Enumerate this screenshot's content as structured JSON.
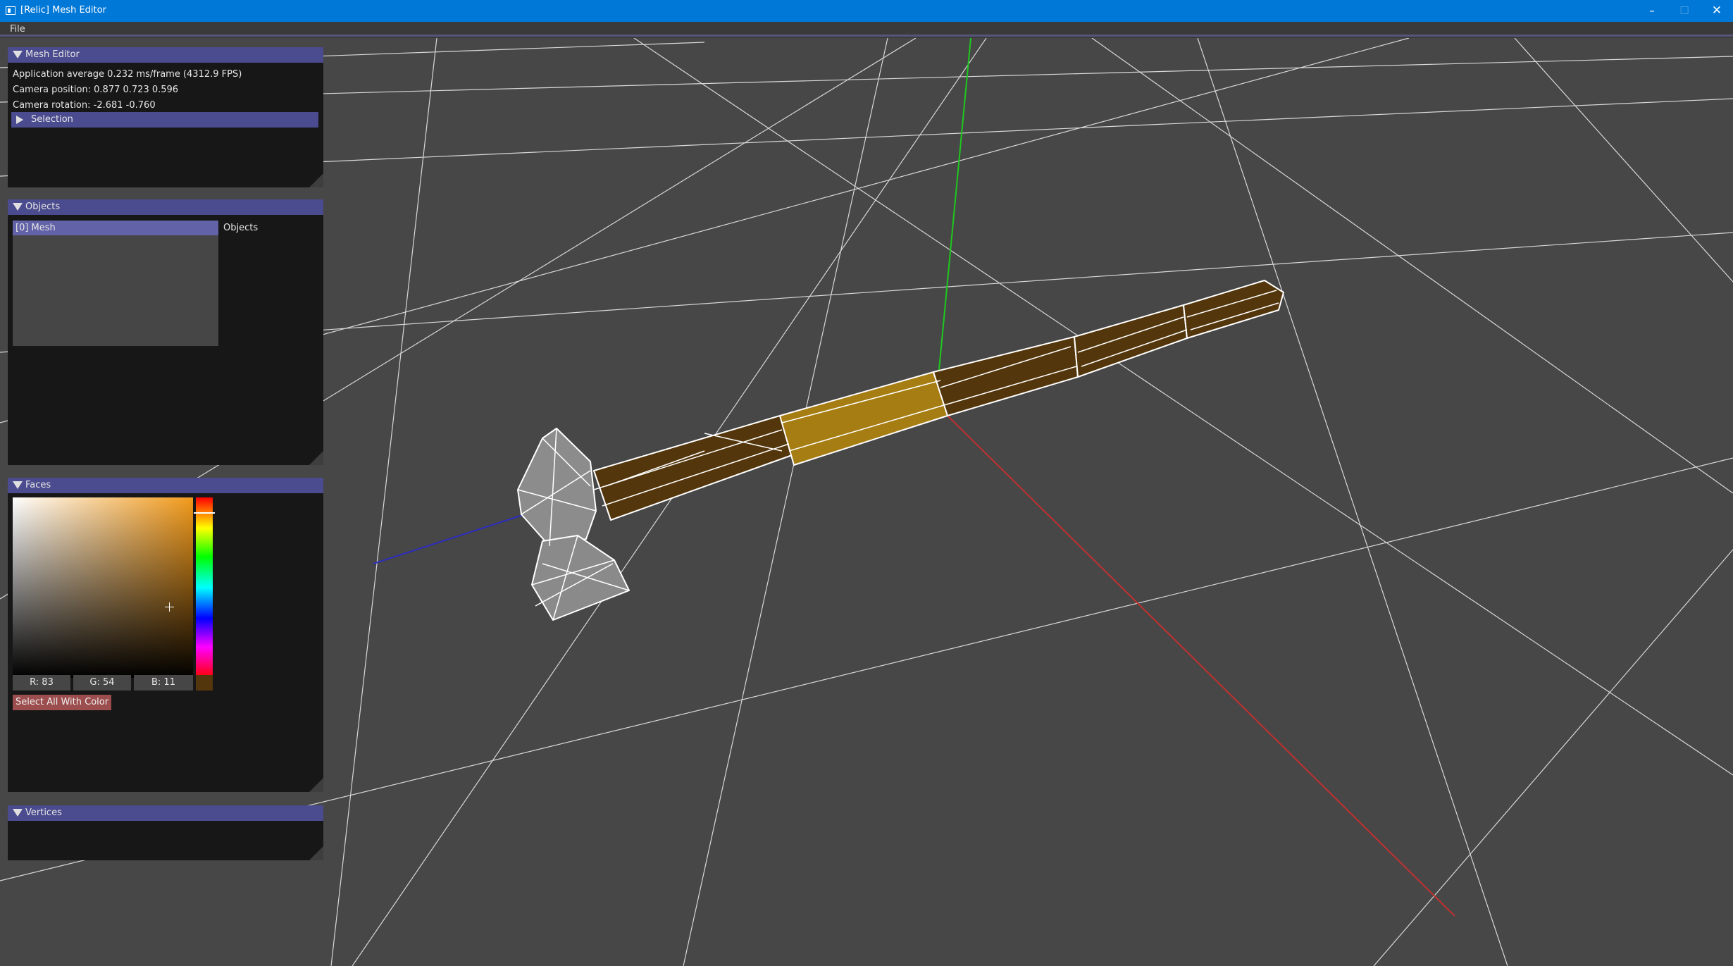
{
  "window": {
    "title": "[Relic] Mesh Editor",
    "icon": "app-window-icon",
    "controls": {
      "minimize": "–",
      "maximize": "☐",
      "close": "✕"
    }
  },
  "menubar": {
    "items": [
      "File"
    ]
  },
  "panels": {
    "mesh_editor": {
      "title": "Mesh Editor",
      "lines": [
        "Application average 0.232 ms/frame (4312.9 FPS)",
        "Camera position: 0.877 0.723 0.596",
        "Camera rotation: -2.681 -0.760"
      ],
      "selection_label": "Selection"
    },
    "objects": {
      "title": "Objects",
      "items": [
        "[0] Mesh"
      ],
      "list_label": "Objects"
    },
    "faces": {
      "title": "Faces",
      "color": {
        "r": "R: 83",
        "g": "G: 54",
        "b": "B: 11",
        "hex": "#53360b"
      },
      "select_button": "Select All With Color"
    },
    "vertices": {
      "title": "Vertices"
    }
  },
  "colors": {
    "titlebar": "#0078d7",
    "viewport": "#474747",
    "panel_bg": "#171717",
    "panel_header": "#4b4b8f",
    "mesh_handle": "#53360b",
    "mesh_selected": "#a67d12",
    "axis_x": "#c03030",
    "axis_y": "#1ec81e",
    "axis_z": "#2d2dbe"
  }
}
